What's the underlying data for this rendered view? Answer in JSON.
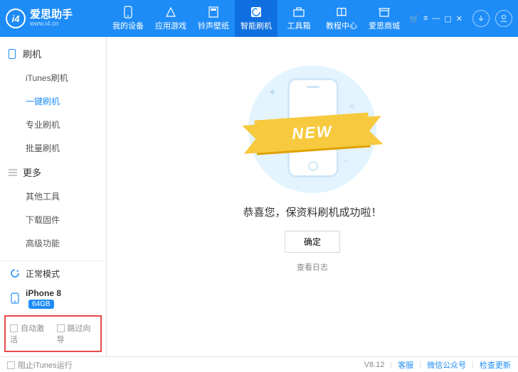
{
  "app": {
    "name_cn": "爱思助手",
    "name_en": "www.i4.cn",
    "logo_text": "i4"
  },
  "nav": [
    {
      "label": "我的设备"
    },
    {
      "label": "应用游戏"
    },
    {
      "label": "铃声壁纸"
    },
    {
      "label": "智能刷机"
    },
    {
      "label": "工具箱"
    },
    {
      "label": "教程中心"
    },
    {
      "label": "爱思商城"
    }
  ],
  "sidebar": {
    "group1": {
      "title": "刷机",
      "items": [
        "iTunes刷机",
        "一键刷机",
        "专业刷机",
        "批量刷机"
      ]
    },
    "group2": {
      "title": "更多",
      "items": [
        "其他工具",
        "下载固件",
        "高级功能"
      ]
    },
    "mode": "正常模式",
    "device": "iPhone 8",
    "storage": "64GB",
    "opt1": "自动激活",
    "opt2": "跳过向导"
  },
  "main": {
    "ribbon": "NEW",
    "message": "恭喜您，保资料刷机成功啦！",
    "confirm": "确定",
    "log": "查看日志"
  },
  "footer": {
    "block_itunes": "阻止iTunes运行",
    "version": "V8.12",
    "support": "客服",
    "wechat": "微信公众号",
    "update": "检查更新"
  }
}
